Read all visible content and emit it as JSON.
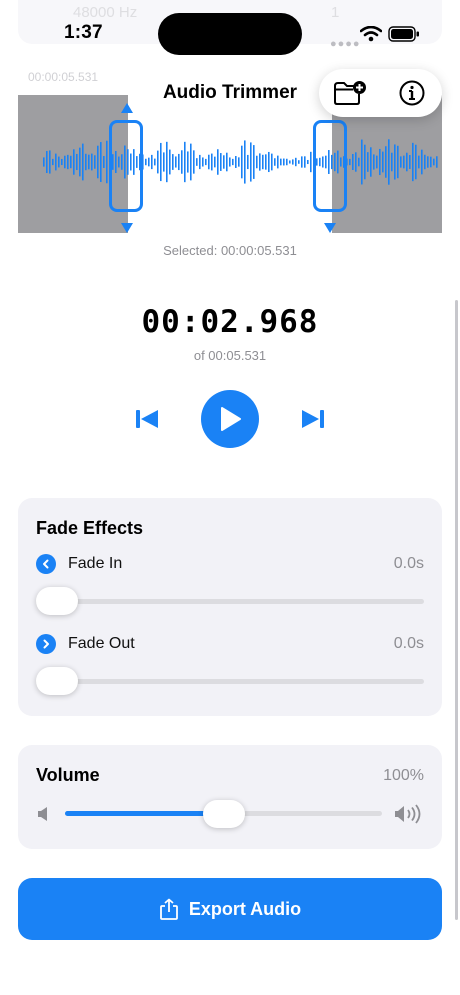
{
  "status_bar": {
    "time": "1:37",
    "ghost_sample_rate": "48000 Hz",
    "ghost_channels": "1"
  },
  "nav": {
    "title": "Audio Trimmer",
    "ghost_date": "00:00:05.531",
    "open_icon": "folder-plus-icon",
    "info_icon": "info-icon"
  },
  "waveform": {
    "selected_label": "Selected: 00:00:05.531",
    "accent": "#1a82f5"
  },
  "player": {
    "current_time": "00:02.968",
    "duration_label": "of 00:05.531"
  },
  "fade_effects": {
    "title": "Fade Effects",
    "fade_in": {
      "label": "Fade In",
      "value": "0.0s",
      "level": 0
    },
    "fade_out": {
      "label": "Fade Out",
      "value": "0.0s",
      "level": 0
    }
  },
  "volume": {
    "title": "Volume",
    "value": "100%",
    "level": 0.5
  },
  "export": {
    "label": "Export Audio"
  }
}
